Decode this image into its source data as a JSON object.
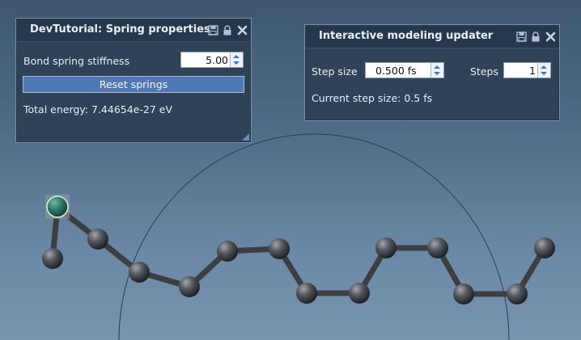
{
  "spring_panel": {
    "title": "DevTutorial: Spring properties",
    "stiffness_label": "Bond spring stiffness",
    "stiffness_value": "5.00",
    "reset_label": "Reset springs",
    "energy_text": "Total energy: 7.44654e-27 eV"
  },
  "updater_panel": {
    "title": "Interactive modeling updater",
    "step_size_label": "Step size",
    "step_size_value": "0.500 fs",
    "steps_label": "Steps",
    "steps_value": "1",
    "current_step_text": "Current step size: 0.5 fs"
  },
  "icons": [
    "save-icon",
    "lock-icon",
    "close-icon"
  ],
  "colors": {
    "atom": "#4a4d52",
    "selected_atom": "#2f7a68",
    "selection_box": "#7f8c8a",
    "accent": "#4f79b6"
  }
}
